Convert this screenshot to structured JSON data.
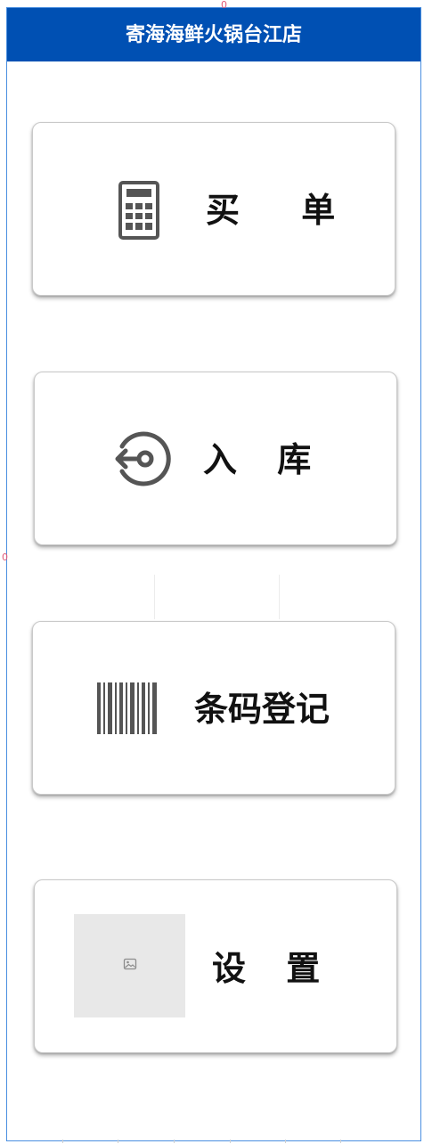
{
  "header": {
    "title": "寄海海鲜火锅台江店",
    "background": "#0050b3"
  },
  "buttons": [
    {
      "label": "买 单",
      "icon": "calculator-icon"
    },
    {
      "label": "入 库",
      "icon": "inbound-arrow-icon"
    },
    {
      "label": "条码登记",
      "icon": "barcode-icon"
    },
    {
      "label": "设 置",
      "icon": "image-placeholder-icon"
    }
  ],
  "guide_markers": {
    "top": "0",
    "left": "0"
  }
}
